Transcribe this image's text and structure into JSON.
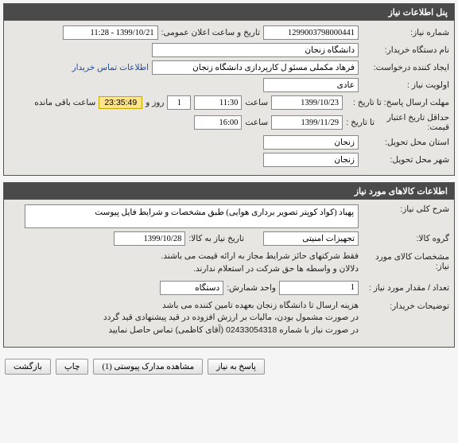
{
  "panel1": {
    "title": "پنل اطلاعات نیاز",
    "req_no_label": "شماره نیاز:",
    "req_no": "1299003798000441",
    "announce_label": "تاریخ و ساعت اعلان عمومی:",
    "announce_value": "1399/10/21 - 11:28",
    "org_label": "نام دستگاه خریدار:",
    "org_value": "دانشگاه زنجان",
    "creator_label": "ایجاد کننده درخواست:",
    "creator_value": "فرهاد مکملی مسئو ل کارپردازی دانشگاه زنجان",
    "contact_link": "اطلاعات تماس خریدار",
    "priority_label": "اولویت نیاز :",
    "priority_value": "عادی",
    "deadline_send_label": "مهلت ارسال پاسخ:  تا تاریخ :",
    "deadline_send_date": "1399/10/23",
    "time_label": "ساعت",
    "deadline_send_time": "11:30",
    "days_value": "1",
    "days_label": "روز و",
    "countdown": "23:35:49",
    "remaining_label": "ساعت باقی مانده",
    "validity_label": "حداقل تاریخ اعتبار قیمت:",
    "validity_sub": "تا تاریخ :",
    "validity_date": "1399/11/29",
    "validity_time": "16:00",
    "province_label": "استان محل تحویل:",
    "province_value": "زنجان",
    "city_label": "شهر محل تحویل:",
    "city_value": "زنجان"
  },
  "panel2": {
    "title": "اطلاعات کالاهای مورد نیاز",
    "desc_label": "شرح کلی نیاز:",
    "desc_value": "پهباد (کواد کوپتر تصویر برداری هوایی) طبق مشخصات و شرایط فایل پیوست",
    "group_label": "گروه کالا:",
    "group_value": "تجهیزات امنیتی",
    "need_date_label": "تاریخ نیاز به کالا:",
    "need_date_value": "1399/10/28",
    "spec_label": "مشخصات کالای مورد نیاز:",
    "spec_line1": "فقط شرکتهای حائز شرایط مجاز به ارائه قیمت می باشند.",
    "spec_line2": "دلالان و واسطه ها حق شرکت در استعلام ندارند.",
    "qty_label": "تعداد / مقدار مورد نیاز :",
    "qty_value": "1",
    "unit_label": "واحد شمارش:",
    "unit_value": "دستگاه",
    "buyer_notes_label": "توضیحات خریدار:",
    "buyer_notes_line1": "هزینه ارسال تا دانشگاه زنجان بعهده تامین کننده می باشد",
    "buyer_notes_line2": "در صورت مشمول بودن، مالیات بر ارزش افزوده در قید پیشنهادی قید گردد",
    "buyer_notes_line3": "در صورت نیاز با شماره 02433054318 (آقای کاظمی) تماس حاصل نمایید"
  },
  "buttons": {
    "respond": "پاسخ به نیاز",
    "attachments": "مشاهده مدارک پیوستی (1)",
    "print": "چاپ",
    "back": "بازگشت"
  }
}
